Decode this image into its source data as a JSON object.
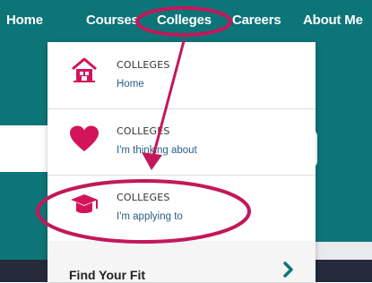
{
  "nav": {
    "items": [
      "Home",
      "Courses",
      "Colleges",
      "Careers",
      "About Me"
    ]
  },
  "dropdown": {
    "items": [
      {
        "title": "COLLEGES",
        "subtitle": "Home",
        "icon": "home-icon"
      },
      {
        "title": "COLLEGES",
        "subtitle": "I'm thinking about",
        "icon": "heart-icon"
      },
      {
        "title": "COLLEGES",
        "subtitle": "I'm applying to",
        "icon": "graduation-cap-icon"
      }
    ],
    "find_fit": "Find Your Fit"
  },
  "colors": {
    "teal": "#0d7478",
    "accent": "#d3145a",
    "annotation": "#c2185b"
  }
}
